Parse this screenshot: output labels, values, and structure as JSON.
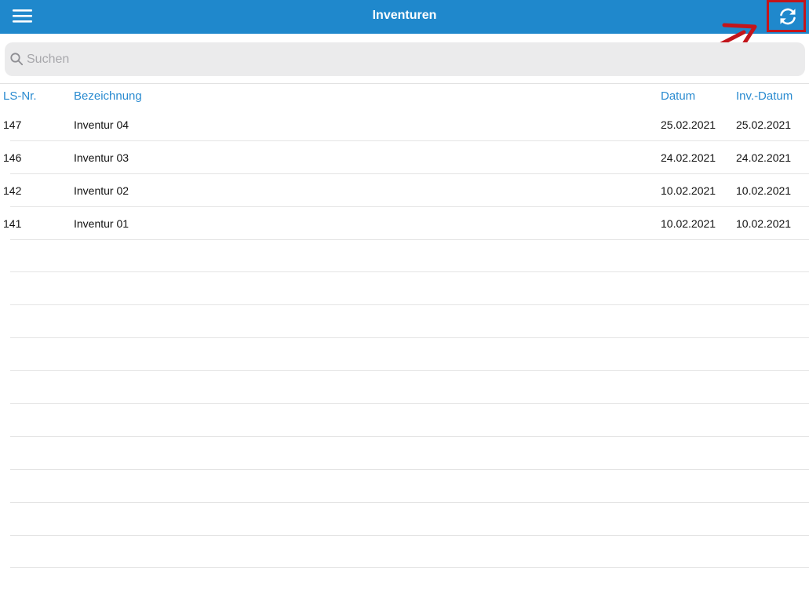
{
  "header": {
    "title": "Inventuren",
    "menu_icon": "hamburger-menu-icon",
    "refresh_icon": "refresh-icon"
  },
  "search": {
    "placeholder": "Suchen",
    "value": ""
  },
  "table": {
    "columns": [
      "LS-Nr.",
      "Bezeichnung",
      "Datum",
      "Inv.-Datum"
    ],
    "rows": [
      {
        "ls_nr": "147",
        "bezeichnung": "Inventur 04",
        "datum": "25.02.2021",
        "inv_datum": "25.02.2021"
      },
      {
        "ls_nr": "146",
        "bezeichnung": "Inventur 03",
        "datum": "24.02.2021",
        "inv_datum": "24.02.2021"
      },
      {
        "ls_nr": "142",
        "bezeichnung": "Inventur 02",
        "datum": "10.02.2021",
        "inv_datum": "10.02.2021"
      },
      {
        "ls_nr": "141",
        "bezeichnung": "Inventur 01",
        "datum": "10.02.2021",
        "inv_datum": "10.02.2021"
      }
    ]
  },
  "colors": {
    "navbar": "#1f88cc",
    "header_text": "#2a8bd0",
    "annotation": "#c3151b"
  }
}
